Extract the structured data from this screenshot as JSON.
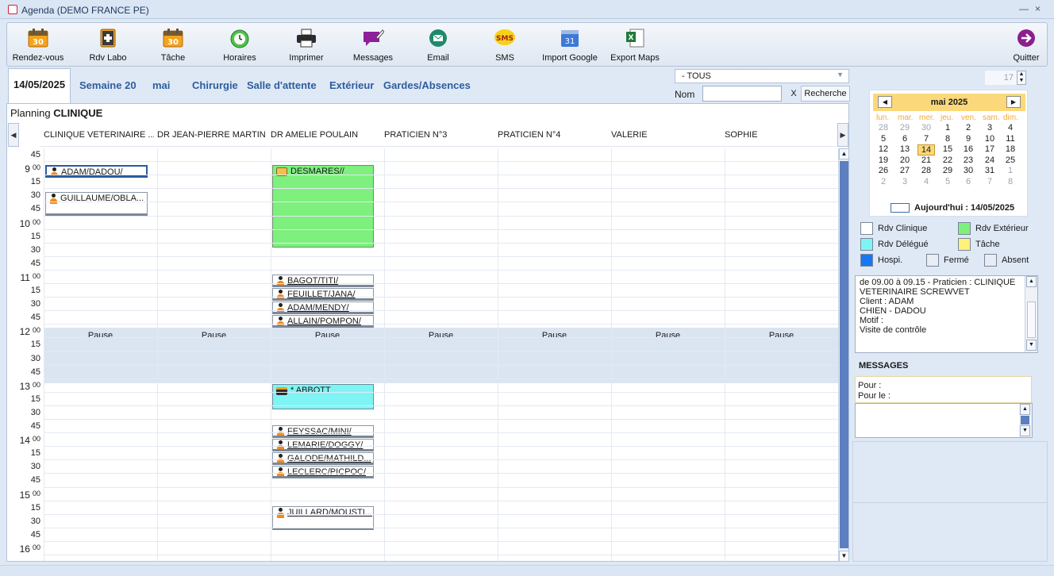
{
  "window": {
    "title": "Agenda (DEMO FRANCE PE)",
    "minimize": "—",
    "close": "×"
  },
  "toolbar": {
    "buttons": [
      {
        "label": "Rendez-vous",
        "icon": "calendar-30-icon"
      },
      {
        "label": "Rdv Labo",
        "icon": "labo-icon"
      },
      {
        "label": "Tâche",
        "icon": "calendar-30-icon"
      },
      {
        "label": "Horaires",
        "icon": "alarm-clock-icon"
      },
      {
        "label": "Imprimer",
        "icon": "printer-icon"
      },
      {
        "label": "Messages",
        "icon": "message-icon"
      },
      {
        "label": "Email",
        "icon": "email-icon"
      },
      {
        "label": "SMS",
        "icon": "sms-icon"
      },
      {
        "label": "Import Google",
        "icon": "google-calendar-icon"
      },
      {
        "label": "Export Maps",
        "icon": "excel-icon"
      }
    ],
    "quit_label": "Quitter"
  },
  "tabs": {
    "date": "14/05/2025",
    "week": "Semaine 20",
    "month": "mai",
    "surgery": "Chirurgie",
    "waiting": "Salle d'attente",
    "outside": "Extérieur",
    "guards": "Gardes/Absences"
  },
  "filter": {
    "selected": "- TOUS",
    "nom_label": "Nom",
    "nom_value": "",
    "clear_label": "X",
    "search_label": "Recherche"
  },
  "spin_value": "17",
  "planning": {
    "prefix": "Planning",
    "name": "CLINIQUE",
    "columns": [
      "CLINIQUE VETERINAIRE ...",
      "DR JEAN-PIERRE MARTIN",
      "DR AMELIE POULAIN",
      "PRATICIEN N°3",
      "PRATICIEN N°4",
      "VALERIE",
      "SOPHIE"
    ],
    "pause_label": "Pause",
    "appointments": [
      {
        "label": "ADAM/DADOU/"
      },
      {
        "label": "GUILLAUME/OBLA..."
      },
      {
        "label": "DESMARES//"
      },
      {
        "label": "BAGOT/TITI/"
      },
      {
        "label": "FEUILLET/JANA/"
      },
      {
        "label": "ADAM/MENDY/"
      },
      {
        "label": "ALLAIN/POMPON/"
      },
      {
        "label": "* ABBOTT"
      },
      {
        "label": "FEYSSAC/MINI/"
      },
      {
        "label": "LEMARIE/DOGGY/"
      },
      {
        "label": "GALODE/MATHILD..."
      },
      {
        "label": "LECLERC/PICPOC/"
      },
      {
        "label": "JUILLARD/MOUSTI..."
      }
    ]
  },
  "calendar": {
    "month_title": "mai 2025",
    "weekdays": [
      "lun.",
      "mar.",
      "mer.",
      "jeu.",
      "ven.",
      "sam.",
      "dim."
    ],
    "weeks": [
      [
        "28",
        "29",
        "30",
        "1",
        "2",
        "3",
        "4"
      ],
      [
        "5",
        "6",
        "7",
        "8",
        "9",
        "10",
        "11"
      ],
      [
        "12",
        "13",
        "14",
        "15",
        "16",
        "17",
        "18"
      ],
      [
        "19",
        "20",
        "21",
        "22",
        "23",
        "24",
        "25"
      ],
      [
        "26",
        "27",
        "28",
        "29",
        "30",
        "31",
        "1"
      ],
      [
        "2",
        "3",
        "4",
        "5",
        "6",
        "7",
        "8"
      ]
    ],
    "today_label": "Aujourd'hui : 14/05/2025"
  },
  "legend": {
    "rdv_clinique": "Rdv Clinique",
    "rdv_exterieur": "Rdv Extérieur",
    "rdv_delegue": "Rdv Délégué",
    "tache": "Tâche",
    "hospi": "Hospi.",
    "ferme": "Fermé",
    "absent": "Absent",
    "colors": {
      "clinique": "#ffffff",
      "exterieur": "#7df07d",
      "delegue": "#7ff4f5",
      "tache": "#fdf27a",
      "hospi": "#1877f2",
      "ferme": "#e8edf5",
      "absent": "#e8edf5"
    }
  },
  "detail": {
    "line1": "de 09.00 à 09.15 - Praticien : CLINIQUE VETERINAIRE SCREWVET",
    "line2": "Client : ADAM",
    "line3": "CHIEN - DADOU",
    "line4": "Motif :",
    "line5": "Visite de contrôle"
  },
  "messages": {
    "title": "MESSAGES",
    "pour": "Pour :",
    "pour_le": "Pour le :"
  }
}
